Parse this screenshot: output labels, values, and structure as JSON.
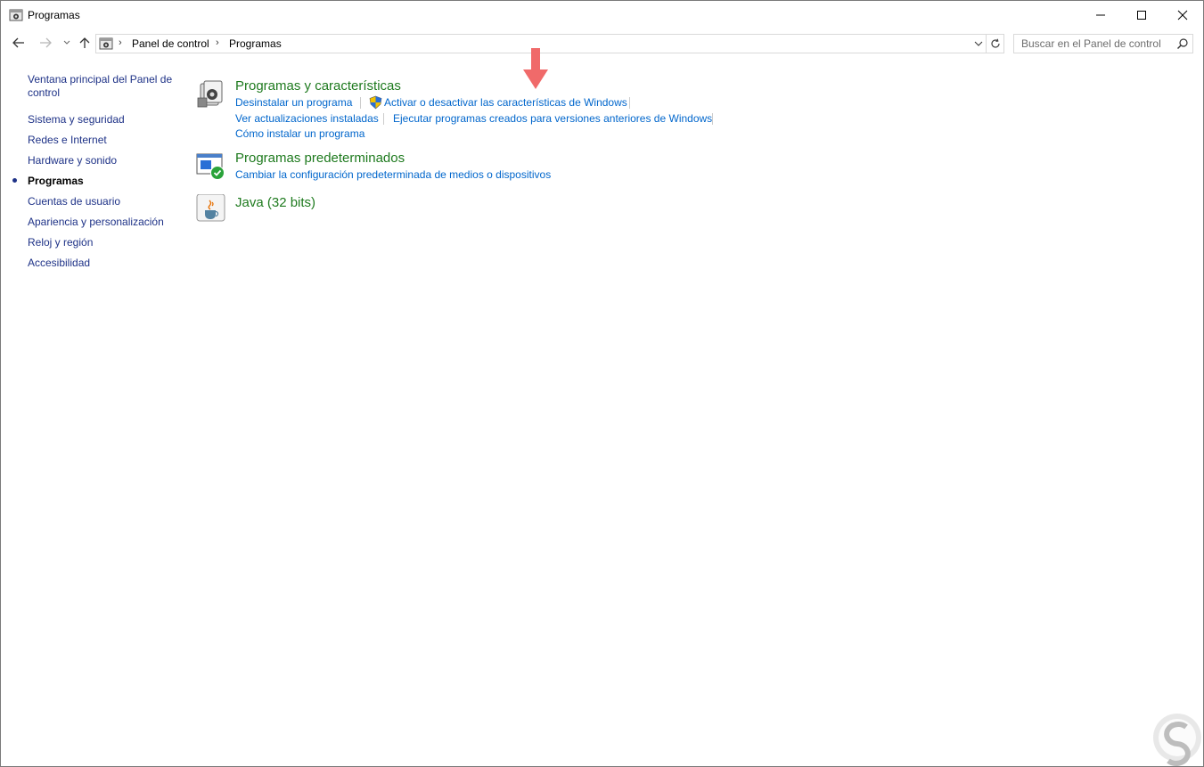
{
  "window": {
    "title": "Programas"
  },
  "address_bar": {
    "crumbs": [
      "Panel de control",
      "Programas"
    ]
  },
  "search": {
    "placeholder": "Buscar en el Panel de control"
  },
  "sidebar": {
    "items": [
      {
        "label": "Ventana principal del Panel de control",
        "active": false
      },
      {
        "label": "Sistema y seguridad",
        "active": false
      },
      {
        "label": "Redes e Internet",
        "active": false
      },
      {
        "label": "Hardware y sonido",
        "active": false
      },
      {
        "label": "Programas",
        "active": true
      },
      {
        "label": "Cuentas de usuario",
        "active": false
      },
      {
        "label": "Apariencia y personalización",
        "active": false
      },
      {
        "label": "Reloj y región",
        "active": false
      },
      {
        "label": "Accesibilidad",
        "active": false
      }
    ]
  },
  "main": {
    "categories": [
      {
        "title": "Programas y características",
        "icon": "programs-features-icon",
        "links": [
          "Desinstalar un programa",
          "Activar o desactivar las características de Windows",
          "Ver actualizaciones instaladas",
          "Ejecutar programas creados para versiones anteriores de Windows",
          "Cómo instalar un programa"
        ]
      },
      {
        "title": "Programas predeterminados",
        "icon": "default-programs-icon",
        "links": [
          "Cambiar la configuración predeterminada de medios o dispositivos"
        ]
      },
      {
        "title": "Java (32 bits)",
        "icon": "java-icon",
        "links": []
      }
    ]
  },
  "colors": {
    "category_title": "#1e7a1e",
    "link": "#0066cc",
    "sidebar_link": "#1e3287",
    "annotation_arrow": "#f06a6a"
  }
}
